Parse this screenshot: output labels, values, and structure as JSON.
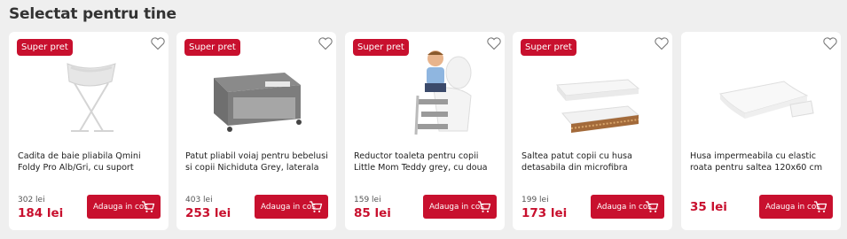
{
  "section": {
    "title": "Selectat pentru tine"
  },
  "cart_label": "Adauga in cos",
  "products": [
    {
      "badge": "Super pret",
      "title": "Cadita de baie pliabila Qmini Foldy Pro Alb/Gri, cu suport metalic si",
      "old_price": "302 lei",
      "price": "184 lei",
      "image_icon": "foldable-bathtub"
    },
    {
      "badge": "Super pret",
      "title": "Patut pliabil voiaj pentru bebelusi si copii Nichiduta Grey, laterala",
      "old_price": "403 lei",
      "price": "253 lei",
      "image_icon": "travel-cot"
    },
    {
      "badge": "Super pret",
      "title": "Reductor toaleta pentru copii Little Mom Teddy grey, cu doua trepte,",
      "old_price": "159 lei",
      "price": "85 lei",
      "image_icon": "potty-ladder"
    },
    {
      "badge": "Super pret",
      "title": "Saltea patut copii cu husa detasabila din microfibra Nichiduta Cocos",
      "old_price": "199 lei",
      "price": "173 lei",
      "image_icon": "mattress"
    },
    {
      "title": "Husa impermeabila cu elastic roata pentru saltea 120x60 cm",
      "price": "35 lei",
      "image_icon": "mattress-cover"
    }
  ],
  "colors": {
    "accent": "#c8102e",
    "background": "#efefef"
  }
}
